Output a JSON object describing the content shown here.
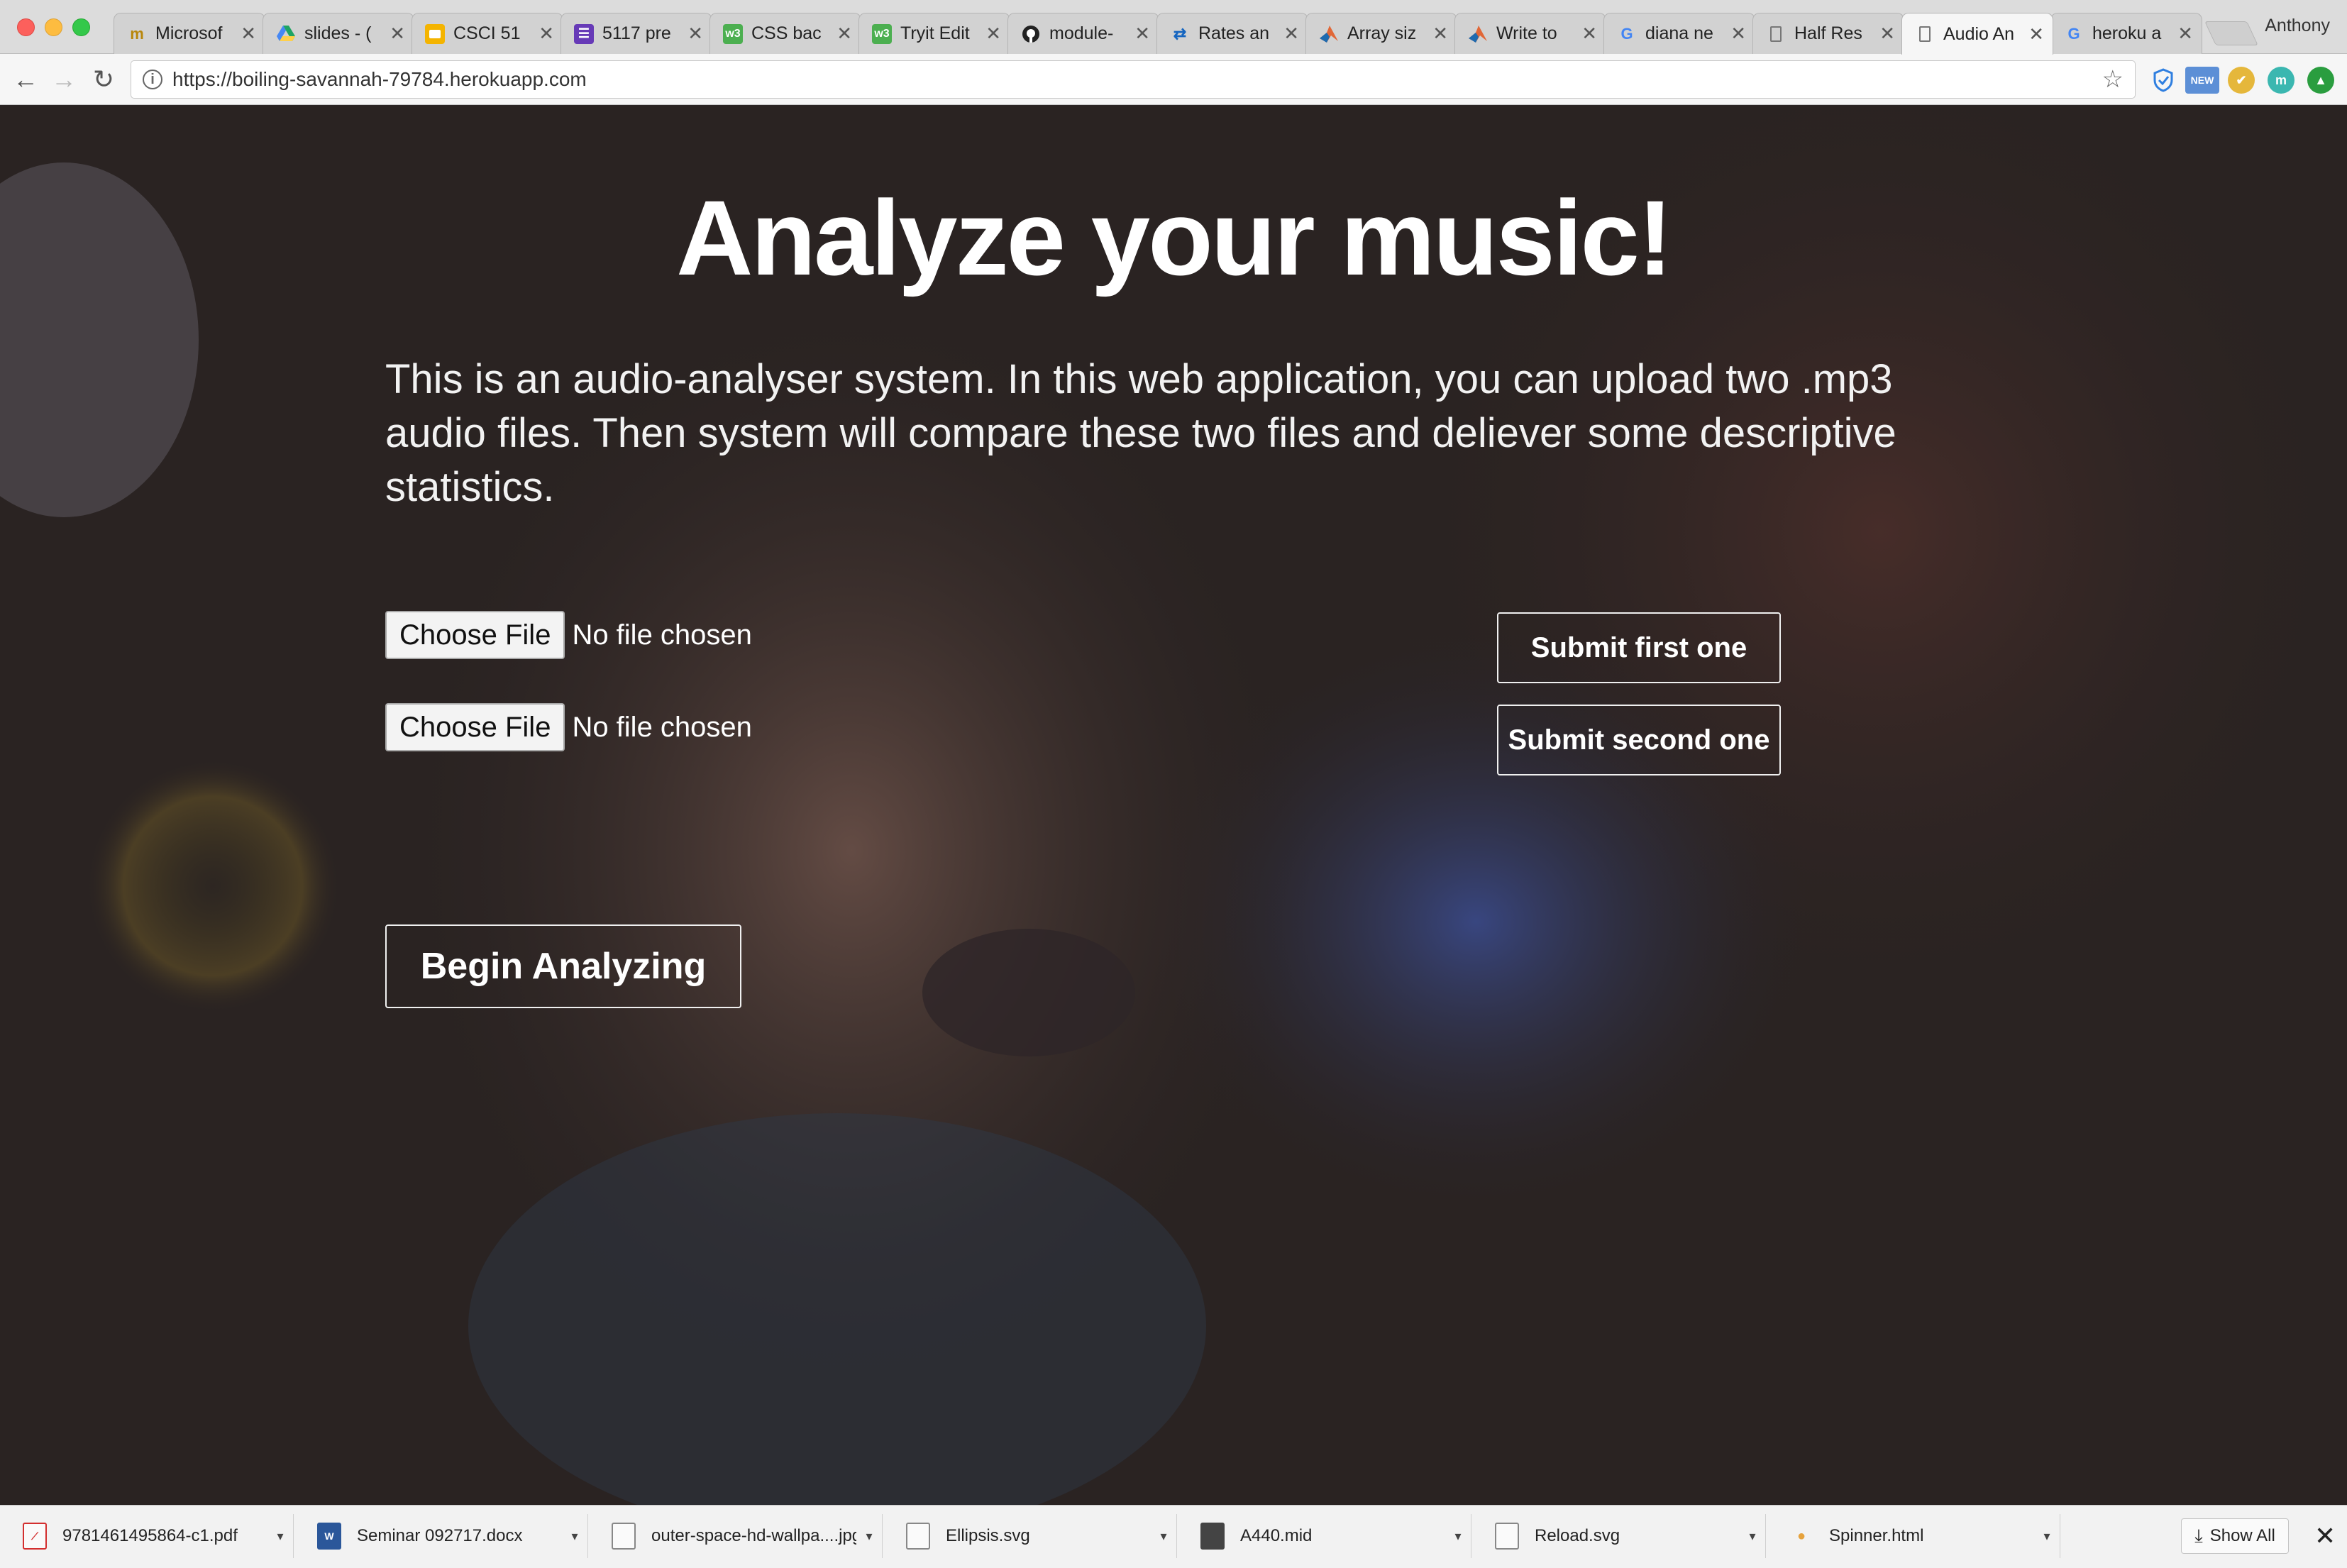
{
  "browser": {
    "tabs": [
      {
        "title": "Microsof",
        "icon": "office-icon"
      },
      {
        "title": "slides - (",
        "icon": "google-drive-icon"
      },
      {
        "title": "CSCI 51",
        "icon": "slides-icon"
      },
      {
        "title": "5117 pre",
        "icon": "forms-icon"
      },
      {
        "title": "CSS bac",
        "icon": "w3schools-icon"
      },
      {
        "title": "Tryit Edit",
        "icon": "w3schools-icon"
      },
      {
        "title": "module-",
        "icon": "github-icon"
      },
      {
        "title": "Rates an",
        "icon": "currency-icon"
      },
      {
        "title": "Array siz",
        "icon": "matlab-icon"
      },
      {
        "title": "Write to",
        "icon": "matlab-icon"
      },
      {
        "title": "diana ne",
        "icon": "google-icon"
      },
      {
        "title": "Half Res",
        "icon": "page-icon"
      },
      {
        "title": "Audio An",
        "icon": "page-icon",
        "active": true
      },
      {
        "title": "heroku a",
        "icon": "google-icon"
      }
    ],
    "profile_name": "Anthony",
    "url": "https://boiling-savannah-79784.herokuapp.com",
    "extensions": [
      "shield-icon",
      "new-badge-icon",
      "chrome-ext-icon",
      "m-ext-icon",
      "green-ext-icon"
    ],
    "extension_labels": {
      "new_badge": "NEW",
      "m_ext": "m"
    }
  },
  "page": {
    "title": "Analyze your music!",
    "intro": "This is an audio-analyser system. In this web application, you can upload two .mp3 audio files. Then system will compare these two files and deliever some descriptive statistics.",
    "file_inputs": [
      {
        "button_label": "Choose File",
        "status": "No file chosen"
      },
      {
        "button_label": "Choose File",
        "status": "No file chosen"
      }
    ],
    "submit_first_label": "Submit first one",
    "submit_second_label": "Submit second one",
    "begin_label": "Begin Analyzing"
  },
  "downloads": {
    "items": [
      {
        "name": "9781461495864-c1.pdf",
        "icon": "pdf-file-icon"
      },
      {
        "name": "Seminar 092717.docx",
        "icon": "word-file-icon"
      },
      {
        "name": "outer-space-hd-wallpa....jpg",
        "icon": "image-file-icon"
      },
      {
        "name": "Ellipsis.svg",
        "icon": "svg-file-icon"
      },
      {
        "name": "A440.mid",
        "icon": "midi-file-icon"
      },
      {
        "name": "Reload.svg",
        "icon": "svg-file-icon"
      },
      {
        "name": "Spinner.html",
        "icon": "html-file-icon"
      }
    ],
    "show_all_label": "Show All"
  },
  "colors": {
    "page_background": "#2a2322",
    "text": "#ffffff",
    "button_border": "#f0f0f0"
  }
}
